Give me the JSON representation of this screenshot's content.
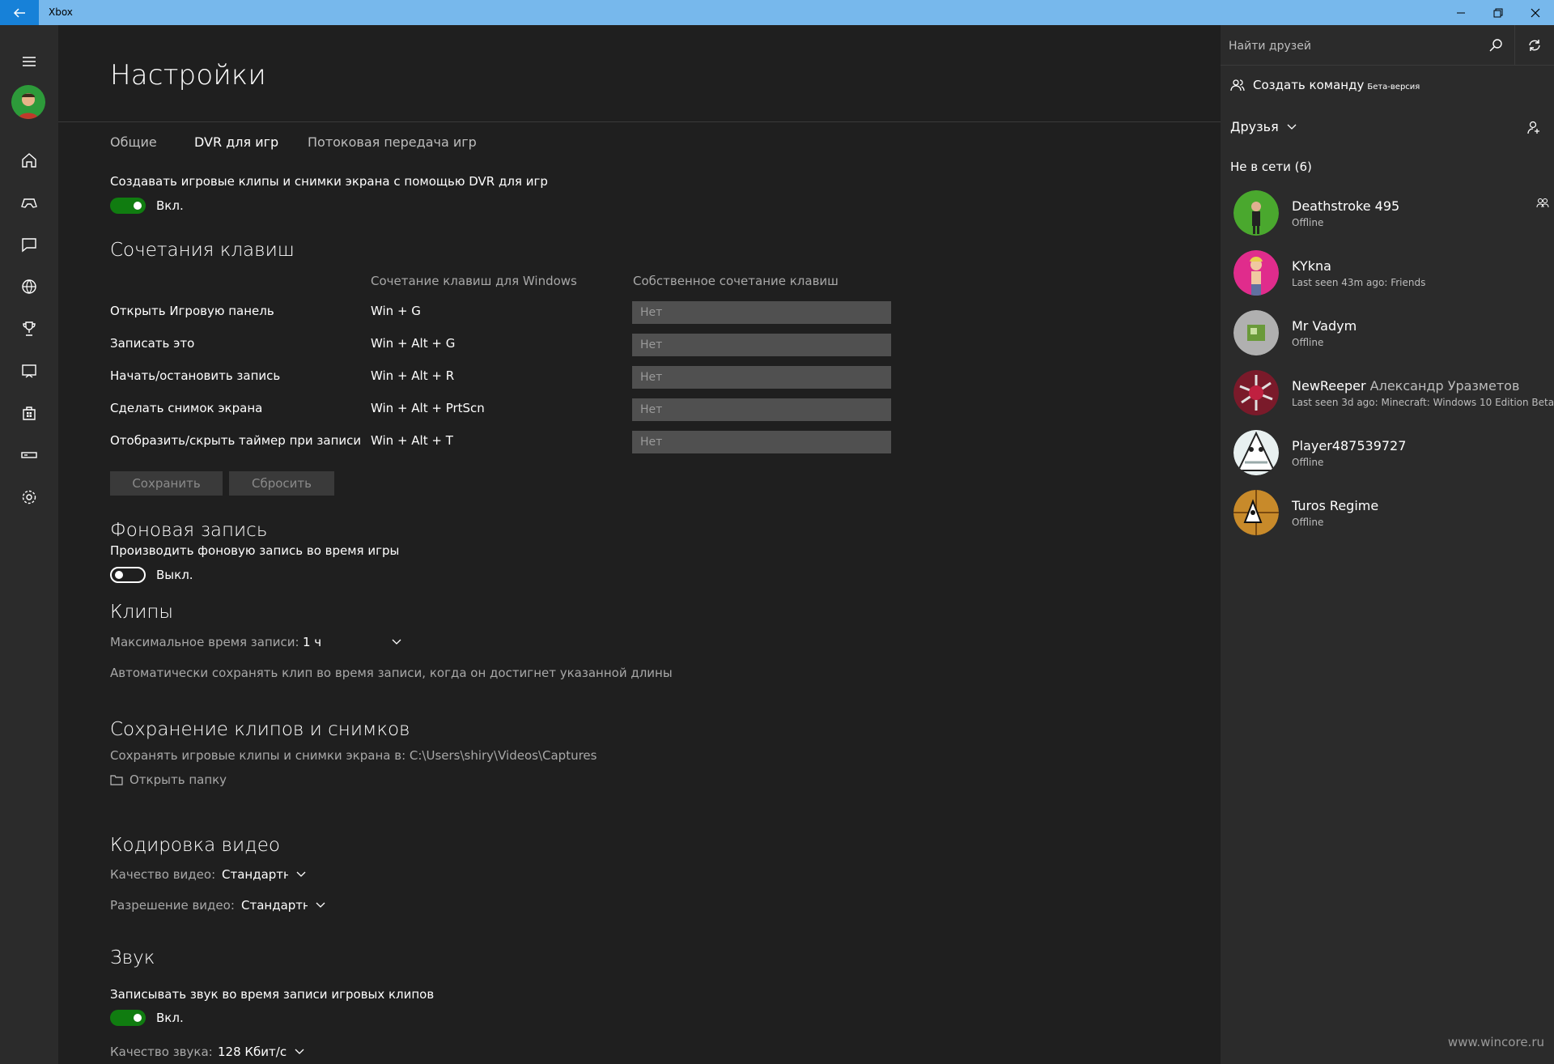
{
  "window": {
    "title": "Xbox"
  },
  "page": {
    "title": "Настройки",
    "tabs": [
      "Общие",
      "DVR для игр",
      "Потоковая передача игр"
    ]
  },
  "dvr": {
    "main_toggle_text": "Создавать игровые клипы и снимки экрана с помощью DVR для игр",
    "main_toggle_state": "Вкл."
  },
  "shortcuts": {
    "title": "Сочетания клавиш",
    "col_windows": "Сочетание клавиш для Windows",
    "col_custom": "Собственное сочетание клавиш",
    "rows": [
      {
        "action": "Открыть Игровую панель",
        "keys": "Win + G",
        "custom": "Нет"
      },
      {
        "action": "Записать это",
        "keys": "Win + Alt + G",
        "custom": "Нет"
      },
      {
        "action": "Начать/остановить запись",
        "keys": "Win + Alt + R",
        "custom": "Нет"
      },
      {
        "action": "Сделать снимок экрана",
        "keys": "Win + Alt + PrtScn",
        "custom": "Нет"
      },
      {
        "action": "Отобразить/скрыть таймер при записи",
        "keys": "Win + Alt + T",
        "custom": "Нет"
      }
    ],
    "save_label": "Сохранить",
    "reset_label": "Сбросить"
  },
  "background": {
    "title": "Фоновая запись",
    "desc": "Производить фоновую запись во время игры",
    "state": "Выкл."
  },
  "clips": {
    "title": "Клипы",
    "max_label": "Максимальное время записи:",
    "max_value": "1 ч",
    "auto_save": "Автоматически сохранять клип во время записи, когда он достигнет указанной длины"
  },
  "saving": {
    "title": "Сохранение клипов и снимков",
    "path_text": "Сохранять игровые клипы и снимки экрана в: C:\\Users\\shiry\\Videos\\Captures",
    "open_folder": "Открыть папку"
  },
  "encoding": {
    "title": "Кодировка видео",
    "quality_label": "Качество видео:",
    "quality_value": "Стандартна",
    "resolution_label": "Разрешение видео:",
    "resolution_value": "Стандартна"
  },
  "audio": {
    "title": "Звук",
    "record_text": "Записывать звук во время записи игровых клипов",
    "record_state": "Вкл.",
    "quality_label": "Качество звука:",
    "quality_value": "128 Кбит/с"
  },
  "friends_panel": {
    "search_placeholder": "Найти друзей",
    "create_team": "Создать команду",
    "beta": "Бета-версия",
    "filter": "Друзья",
    "offline_header": "Не в сети (6)",
    "friends": [
      {
        "name": "Deathstroke 495",
        "real": "",
        "status": "Offline"
      },
      {
        "name": "KYkna",
        "real": "",
        "status": "Last seen 43m ago: Friends"
      },
      {
        "name": "Mr Vadym",
        "real": "",
        "status": "Offline"
      },
      {
        "name": "NewReeper",
        "real": "Александр Уразметов",
        "status": "Last seen 3d ago: Minecraft: Windows 10 Edition Beta"
      },
      {
        "name": "Player487539727",
        "real": "",
        "status": "Offline"
      },
      {
        "name": "Turos Regime",
        "real": "",
        "status": "Offline"
      }
    ]
  },
  "watermark": "www.wincore.ru",
  "colors": {
    "accent": "#107c10",
    "titlebar": "#77b8ec",
    "back_button": "#1781d8"
  }
}
